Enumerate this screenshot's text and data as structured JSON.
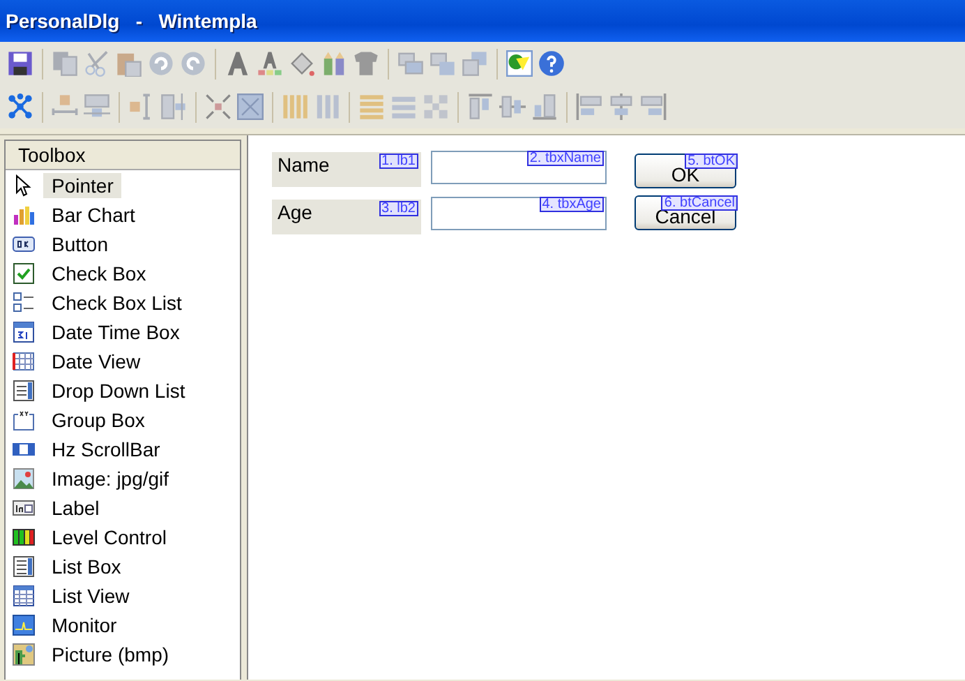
{
  "window": {
    "title": "PersonalDlg   -   Wintempla"
  },
  "toolbox": {
    "title": "Toolbox",
    "items": [
      {
        "label": "Pointer",
        "selected": true
      },
      {
        "label": "Bar Chart",
        "selected": false
      },
      {
        "label": "Button",
        "selected": false
      },
      {
        "label": "Check Box",
        "selected": false
      },
      {
        "label": "Check Box List",
        "selected": false
      },
      {
        "label": "Date Time Box",
        "selected": false
      },
      {
        "label": "Date View",
        "selected": false
      },
      {
        "label": "Drop Down List",
        "selected": false
      },
      {
        "label": "Group Box",
        "selected": false
      },
      {
        "label": "Hz ScrollBar",
        "selected": false
      },
      {
        "label": "Image: jpg/gif",
        "selected": false
      },
      {
        "label": "Label",
        "selected": false
      },
      {
        "label": "Level Control",
        "selected": false
      },
      {
        "label": "List Box",
        "selected": false
      },
      {
        "label": "List View",
        "selected": false
      },
      {
        "label": "Monitor",
        "selected": false
      },
      {
        "label": "Picture (bmp)",
        "selected": false
      }
    ]
  },
  "canvas": {
    "controls": [
      {
        "kind": "label",
        "text": "Name",
        "tag": "1. lb1"
      },
      {
        "kind": "textbox",
        "tag": "2. tbxName"
      },
      {
        "kind": "button",
        "text": "OK",
        "tag": "5. btOK"
      },
      {
        "kind": "label",
        "text": "Age",
        "tag": "3. lb2"
      },
      {
        "kind": "textbox",
        "tag": "4. tbxAge"
      },
      {
        "kind": "button",
        "text": "Cancel",
        "tag": "6. btCancel"
      }
    ]
  }
}
